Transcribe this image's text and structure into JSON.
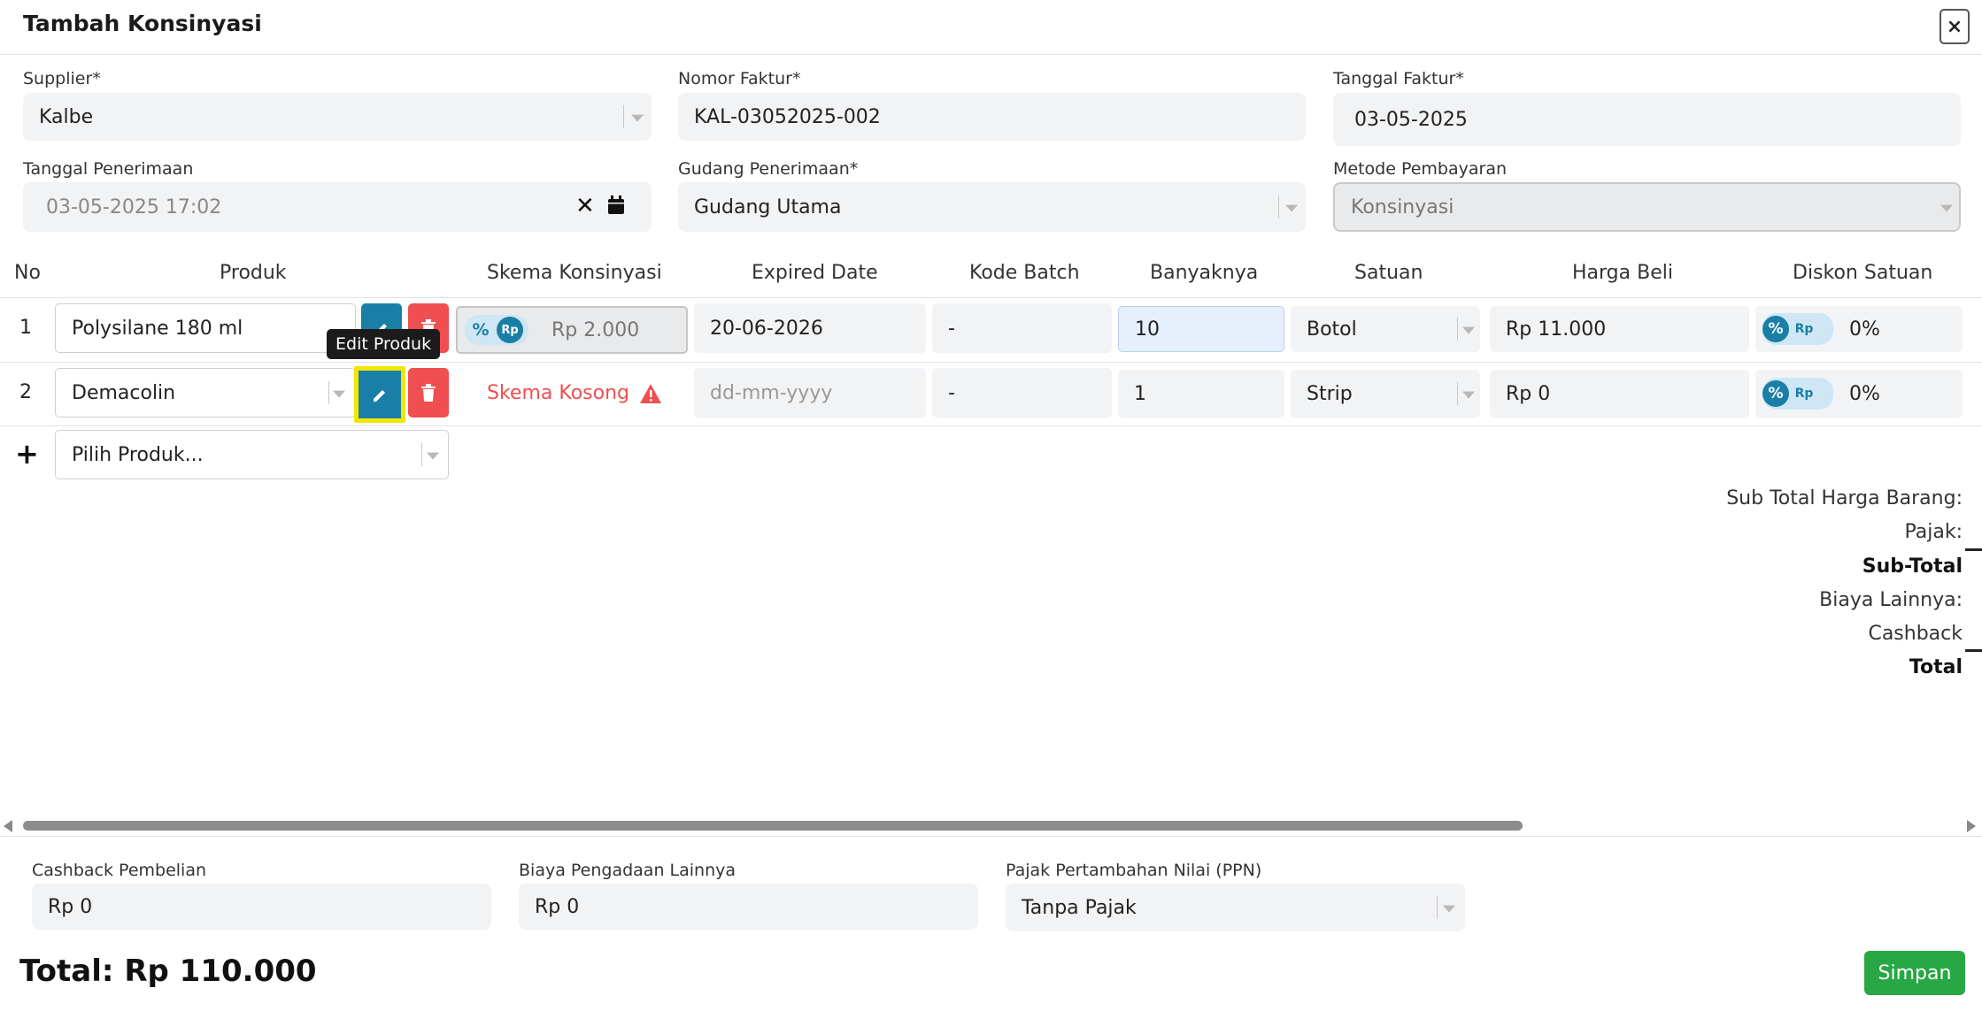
{
  "modal": {
    "title": "Tambah Konsinyasi",
    "close_label": "×"
  },
  "header": {
    "supplier": {
      "label": "Supplier*",
      "value": "Kalbe"
    },
    "nomor_faktur": {
      "label": "Nomor Faktur*",
      "value": "KAL-03052025-002"
    },
    "tanggal_faktur": {
      "label": "Tanggal Faktur*",
      "value": "03-05-2025"
    },
    "tanggal_penerimaan": {
      "label": "Tanggal Penerimaan",
      "value": "03-05-2025 17:02"
    },
    "gudang_penerimaan": {
      "label": "Gudang Penerimaan*",
      "value": "Gudang Utama"
    },
    "metode_pembayaran": {
      "label": "Metode Pembayaran",
      "value": "Konsinyasi"
    }
  },
  "table": {
    "columns": [
      "No",
      "Produk",
      "Skema Konsinyasi",
      "Expired Date",
      "Kode Batch",
      "Banyaknya",
      "Satuan",
      "Harga Beli",
      "Diskon Satuan"
    ],
    "rows": [
      {
        "no": "1",
        "produk": "Polysilane 180 ml",
        "skema_toggle_a": "%",
        "skema_toggle_b": "Rp",
        "skema_value": "Rp 2.000",
        "expired": "20-06-2026",
        "batch": "-",
        "qty": "10",
        "satuan": "Botol",
        "harga": "Rp 11.000",
        "diskon_toggle_a": "%",
        "diskon_toggle_b": "Rp",
        "diskon": "0%"
      },
      {
        "no": "2",
        "produk": "Demacolin",
        "skema_empty": "Skema Kosong",
        "expired_placeholder": "dd-mm-yyyy",
        "batch": "-",
        "qty": "1",
        "satuan": "Strip",
        "harga": "Rp 0",
        "diskon_toggle_a": "%",
        "diskon_toggle_b": "Rp",
        "diskon": "0%"
      }
    ],
    "add_row": {
      "icon": "+",
      "placeholder": "Pilih Produk..."
    },
    "tooltip": "Edit Produk"
  },
  "summary": {
    "sub_total_harga": "Sub Total Harga Barang:",
    "pajak": "Pajak:",
    "sub_total": "Sub-Total",
    "biaya_lainnya": "Biaya Lainnya:",
    "cashback": "Cashback",
    "total": "Total"
  },
  "footer": {
    "cashback": {
      "label": "Cashback Pembelian",
      "value": "Rp 0"
    },
    "biaya": {
      "label": "Biaya Pengadaan Lainnya",
      "value": "Rp 0"
    },
    "ppn": {
      "label": "Pajak Pertambahan Nilai (PPN)",
      "value": "Tanpa Pajak"
    },
    "total": "Total: Rp 110.000",
    "save_label": "Simpan"
  },
  "colors": {
    "primary": "#1a7fa6",
    "danger": "#ef4f50",
    "success": "#28a745",
    "highlight": "#f2e600"
  },
  "icons": [
    "close-icon",
    "clear-icon",
    "calendar-icon",
    "pencil-icon",
    "trash-icon",
    "warning-icon",
    "plus-icon",
    "chevron-down-icon",
    "scroll-left-icon",
    "scroll-right-icon"
  ]
}
